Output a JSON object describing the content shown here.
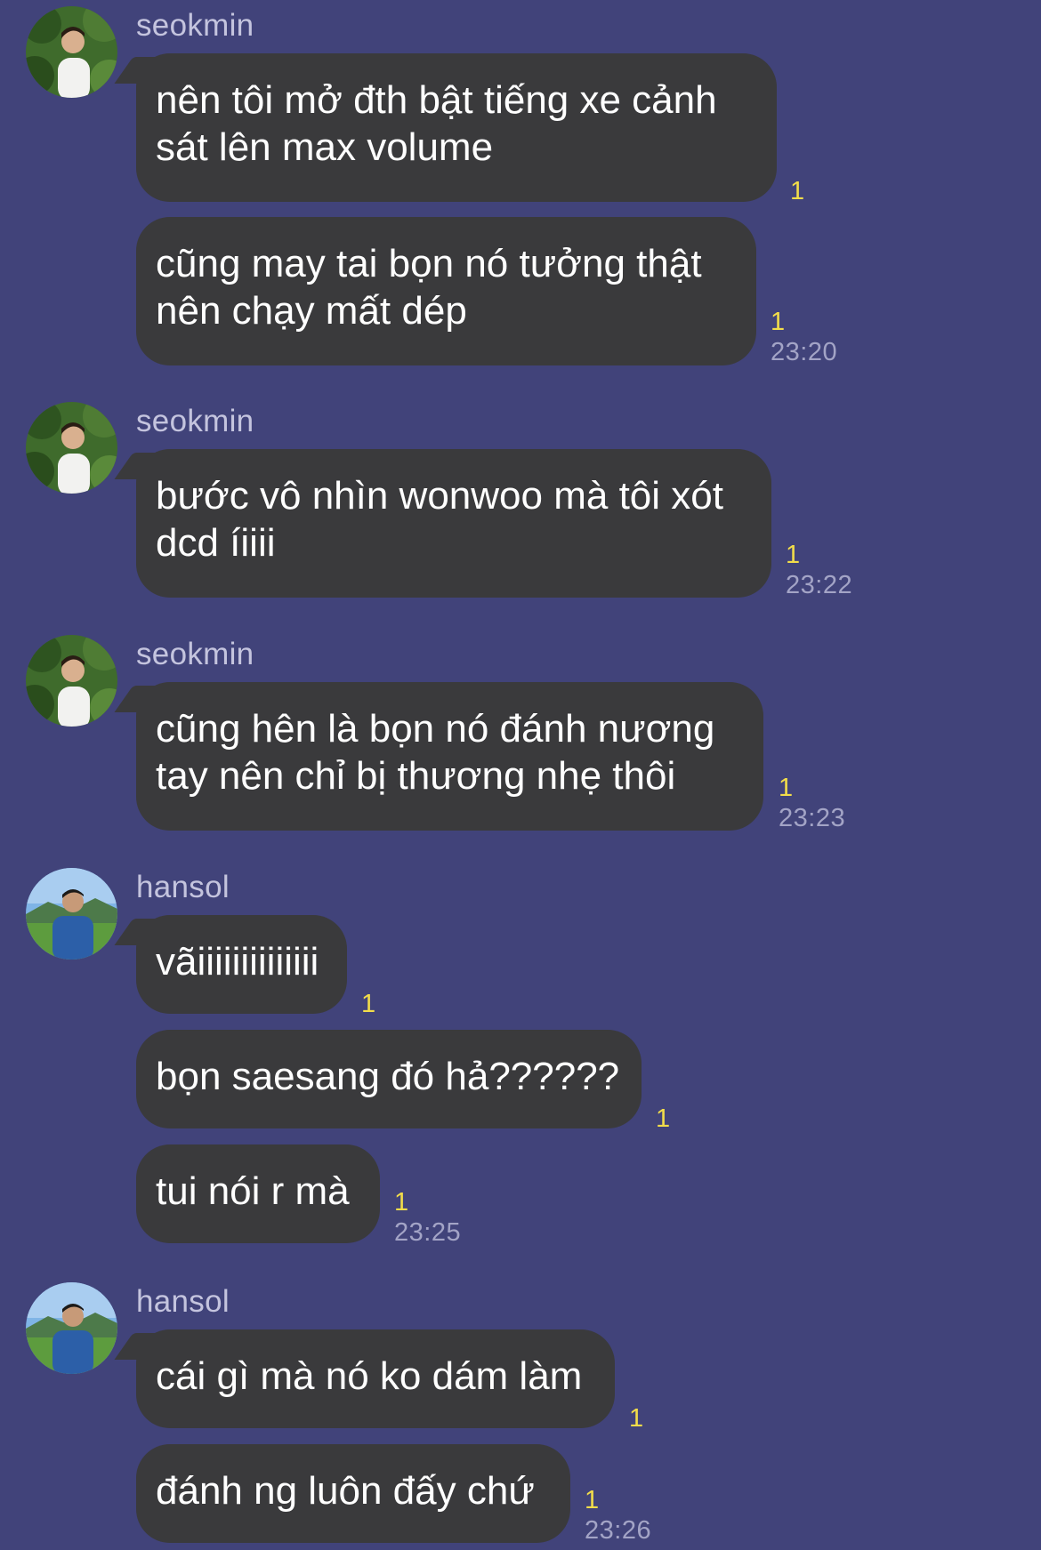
{
  "groups": [
    {
      "sender": "seokmin",
      "avatar_icon": "profile-photo-seokmin",
      "messages": [
        {
          "text": "nên tôi mở đth bật tiếng xe cảnh sát lên max volume",
          "read": "1",
          "time": ""
        },
        {
          "text": "cũng may tai bọn nó tưởng thật nên chạy mất dép",
          "read": "1",
          "time": "23:20"
        }
      ]
    },
    {
      "sender": "seokmin",
      "avatar_icon": "profile-photo-seokmin",
      "messages": [
        {
          "text": "bước vô nhìn wonwoo mà tôi xót dcd íiiii",
          "read": "1",
          "time": "23:22"
        }
      ]
    },
    {
      "sender": "seokmin",
      "avatar_icon": "profile-photo-seokmin",
      "messages": [
        {
          "text": "cũng hên là bọn nó đánh nương tay nên chỉ bị thương nhẹ thôi",
          "read": "1",
          "time": "23:23"
        }
      ]
    },
    {
      "sender": "hansol",
      "avatar_icon": "profile-photo-hansol",
      "messages": [
        {
          "text": "vãiiiiiiiiiiiiii",
          "read": "1",
          "time": ""
        },
        {
          "text": "bọn saesang đó hả??????",
          "read": "1",
          "time": ""
        },
        {
          "text": "tui nói r mà",
          "read": "1",
          "time": "23:25"
        }
      ]
    },
    {
      "sender": "hansol",
      "avatar_icon": "profile-photo-hansol",
      "messages": [
        {
          "text": "cái gì mà nó ko dám làm",
          "read": "1",
          "time": ""
        },
        {
          "text": "đánh ng luôn đấy chứ",
          "read": "1",
          "time": "23:26"
        }
      ]
    }
  ],
  "colors": {
    "background": "#41437a",
    "bubble": "#3a3a3c",
    "read_count": "#f2dd4a",
    "timestamp": "#a3a4c6",
    "sender_name": "#c4c4de"
  }
}
